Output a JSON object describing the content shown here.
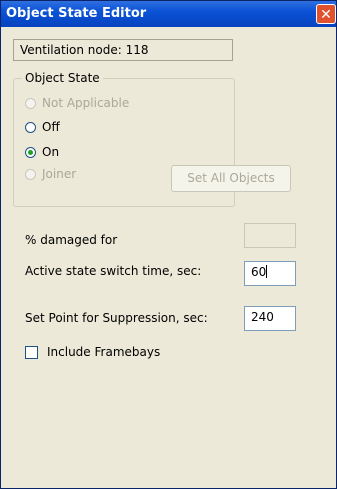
{
  "window": {
    "title": "Object State Editor",
    "close_glyph": "✕"
  },
  "node": {
    "text": "Ventilation node: 118"
  },
  "object_state": {
    "legend": "Object State",
    "options": [
      {
        "label": "Not Applicable",
        "enabled": false,
        "checked": false
      },
      {
        "label": "Off",
        "enabled": true,
        "checked": false
      },
      {
        "label": "On",
        "enabled": true,
        "checked": true
      },
      {
        "label": "Joiner",
        "enabled": false,
        "checked": false
      }
    ],
    "set_all_label": "Set All Objects"
  },
  "fields": {
    "damaged_label": "% damaged for",
    "damaged_value": "",
    "switch_label": "Active state switch time, sec:",
    "switch_value": "60",
    "suppression_label": "Set Point for Suppression, sec:",
    "suppression_value": "240"
  },
  "framebays": {
    "label": "Include Framebays",
    "checked": false
  },
  "colors": {
    "titlebar": "#0a52d6",
    "window_bg": "#ece9d8",
    "accent_radio": "#21a121"
  }
}
